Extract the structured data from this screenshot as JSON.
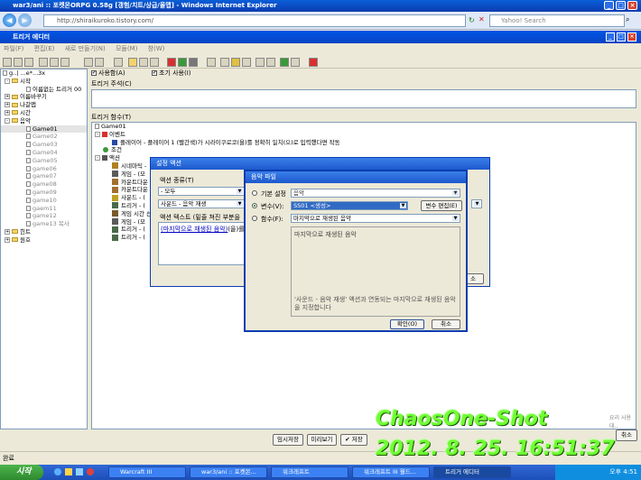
{
  "browser": {
    "title": "war3/ani :: 포켓몬ORPG 0.58g [갱험/치트/상급/올맵] - Windows Internet Explorer",
    "url": "http://shiraikuroko.tistory.com/",
    "search_placeholder": "Yahoo! Search"
  },
  "editor": {
    "title": "트리거 에디터",
    "menu": [
      "파일(F)",
      "편집(E)",
      "새로 만들기(N)",
      "모듈(M)",
      "창(W)"
    ],
    "options": {
      "enabled_label": "사용함(A)",
      "initial_label": "초기 사용(I)"
    },
    "comment_label": "트리거 주석(C)",
    "functions_label": "트리거 함수(T)"
  },
  "tree": {
    "root": "g..| ...e*...3x",
    "rows": [
      {
        "label": "시작",
        "level": 1,
        "type": "folder",
        "exp": "-"
      },
      {
        "label": "이름없는 트리거 00",
        "level": 2,
        "type": "doc"
      },
      {
        "label": "이름바꾸기",
        "level": 1,
        "type": "folder",
        "exp": "+"
      },
      {
        "label": "나갈맵",
        "level": 1,
        "type": "folder",
        "exp": "+"
      },
      {
        "label": "시간",
        "level": 1,
        "type": "folder",
        "exp": "+"
      },
      {
        "label": "음악",
        "level": 1,
        "type": "folder",
        "exp": "-"
      },
      {
        "label": "Game01",
        "level": 2,
        "type": "doc",
        "selected": true
      },
      {
        "label": "Game02",
        "level": 2,
        "type": "doc",
        "dim": true
      },
      {
        "label": "Game03",
        "level": 2,
        "type": "doc",
        "dim": true
      },
      {
        "label": "Game04",
        "level": 2,
        "type": "doc",
        "dim": true
      },
      {
        "label": "Game05",
        "level": 2,
        "type": "doc",
        "dim": true
      },
      {
        "label": "game06",
        "level": 2,
        "type": "doc",
        "dim": true
      },
      {
        "label": "game07",
        "level": 2,
        "type": "doc",
        "dim": true
      },
      {
        "label": "game08",
        "level": 2,
        "type": "doc",
        "dim": true
      },
      {
        "label": "game09",
        "level": 2,
        "type": "doc",
        "dim": true
      },
      {
        "label": "game10",
        "level": 2,
        "type": "doc",
        "dim": true
      },
      {
        "label": "gaem11",
        "level": 2,
        "type": "doc",
        "dim": true
      },
      {
        "label": "game12",
        "level": 2,
        "type": "doc",
        "dim": true
      },
      {
        "label": "game13 복사",
        "level": 2,
        "type": "doc",
        "dim": true
      },
      {
        "label": "힌트",
        "level": 1,
        "type": "folder",
        "exp": "+"
      },
      {
        "label": "원호",
        "level": 1,
        "type": "folder",
        "exp": "+"
      }
    ]
  },
  "functions": {
    "trigger_name": "Game01",
    "event_label": "이벤트",
    "event_text": "플레이어 - 플레이어 1 (빨간색)가 시라이쿠로코(을)를 정확히 일치(으)로 입력했다면 작동",
    "condition_label": "조건",
    "action_label": "액션",
    "actions": [
      "시네마틱 -",
      "게임 - (모",
      "카운트다운",
      "카운트다운",
      "사운드 - (",
      "트리거 - (",
      "게임 시간 선",
      "게임 - (모",
      "트리거 - (",
      "트리거 - ("
    ]
  },
  "action_dialog": {
    "title": "설정 액션",
    "type_label": "액션 종류(T)",
    "type_value": "- 모두",
    "action_value": "사운드 - 음악 재생",
    "text_label": "액션 텍스트 (밑줄 쳐진 부분을",
    "text_link": "(마지막으로 재생된 음악)",
    "text_rest": "(을)를 재",
    "ok_tail": "소"
  },
  "music_dialog": {
    "title": "음악 파일",
    "opt_default": "기본 설정",
    "opt_default_value": "음악",
    "opt_variable": "변수(V):",
    "opt_variable_value": "SS01 <생성>",
    "var_edit": "변수 편집(E)",
    "opt_function": "함수(F):",
    "opt_function_value": "마지막으로 재생된 음악",
    "preview_title": "마지막으로 재생된 음악",
    "preview_desc": "'사운드 - 음악 재생' 액션과 연동되는 마지막으로 재생된 음악을 지정합니다",
    "ok": "확인(O)",
    "cancel": "취소"
  },
  "bottom": {
    "temp_save": "임시저장",
    "preview": "미리보기",
    "save": "✔ 저장",
    "close": "취소",
    "hint": "요리 사용 대.."
  },
  "status": "완료",
  "taskbar": {
    "start": "시작",
    "tasks": [
      "Warcraft III",
      "war3/ani :: 포켓몬...",
      "워크래프트",
      "워크래프트 III 월드...",
      "트리거 에디터"
    ],
    "clock": "오후 4:51"
  },
  "watermark": {
    "line1": "ChaosOne-Shot",
    "line2": "2012. 8. 25. 16:51:37"
  }
}
